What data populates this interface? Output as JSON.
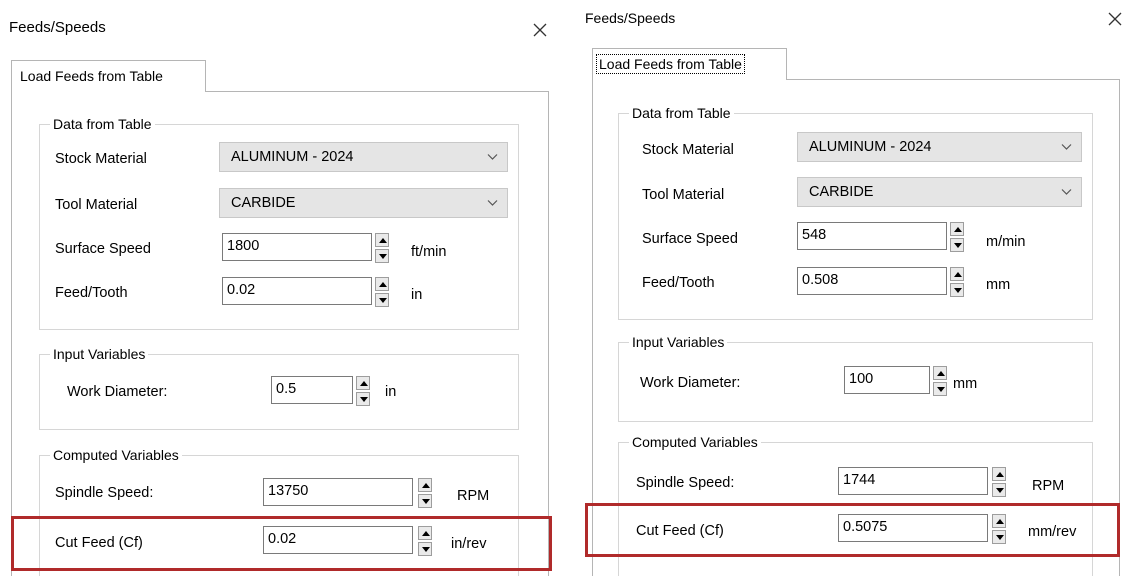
{
  "colors": {
    "highlight": "#b02a2a",
    "combo_bg": "#e5e5e5",
    "border": "#b5b5b5"
  },
  "dialogs": [
    {
      "title": "Feeds/Speeds",
      "close_icon": "close-icon",
      "tab_label": "Load Feeds from Table",
      "data_group": {
        "legend": "Data from Table",
        "stock_material_label": "Stock Material",
        "stock_material_value": "ALUMINUM - 2024",
        "tool_material_label": "Tool Material",
        "tool_material_value": "CARBIDE",
        "surface_speed_label": "Surface Speed",
        "surface_speed_value": "1800",
        "surface_speed_unit": "ft/min",
        "feed_tooth_label": "Feed/Tooth",
        "feed_tooth_value": "0.02",
        "feed_tooth_unit": "in"
      },
      "input_group": {
        "legend": "Input Variables",
        "work_diameter_label": "Work Diameter:",
        "work_diameter_value": "0.5",
        "work_diameter_unit": "in"
      },
      "computed_group": {
        "legend": "Computed Variables",
        "spindle_speed_label": "Spindle Speed:",
        "spindle_speed_value": "13750",
        "spindle_speed_unit": "RPM",
        "cut_feed_label": "Cut Feed (Cf)",
        "cut_feed_value": "0.02",
        "cut_feed_unit": "in/rev"
      }
    },
    {
      "title": "Feeds/Speeds",
      "close_icon": "close-icon",
      "tab_label": "Load Feeds from Table",
      "data_group": {
        "legend": "Data from Table",
        "stock_material_label": "Stock Material",
        "stock_material_value": "ALUMINUM - 2024",
        "tool_material_label": "Tool Material",
        "tool_material_value": "CARBIDE",
        "surface_speed_label": "Surface Speed",
        "surface_speed_value": "548",
        "surface_speed_unit": "m/min",
        "feed_tooth_label": "Feed/Tooth",
        "feed_tooth_value": "0.508",
        "feed_tooth_unit": "mm"
      },
      "input_group": {
        "legend": "Input Variables",
        "work_diameter_label": "Work Diameter:",
        "work_diameter_value": "100",
        "work_diameter_unit": "mm"
      },
      "computed_group": {
        "legend": "Computed Variables",
        "spindle_speed_label": "Spindle Speed:",
        "spindle_speed_value": "1744",
        "spindle_speed_unit": "RPM",
        "cut_feed_label": "Cut Feed (Cf)",
        "cut_feed_value": "0.5075",
        "cut_feed_unit": "mm/rev"
      }
    }
  ]
}
